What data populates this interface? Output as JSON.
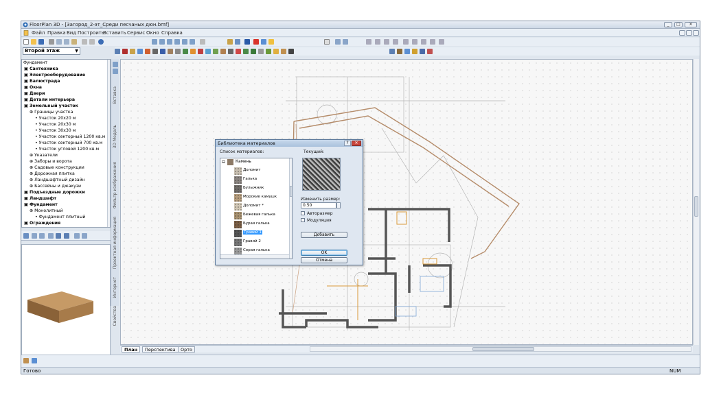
{
  "window": {
    "title": "FloorPlan 3D - [Загород_2-эт_Среди песчаных дюн.bmf]",
    "controls": [
      "_",
      "□",
      "✕"
    ]
  },
  "menu": [
    "Файл",
    "Правка",
    "Вид",
    "Построить",
    "Вставить",
    "Сервис",
    "Окно",
    "Справка"
  ],
  "floor_selector": {
    "value": "Второй этаж"
  },
  "tree": {
    "header": "Фундамент",
    "items": [
      {
        "label": "Сантехника",
        "bold": true,
        "level": 0
      },
      {
        "label": "Электрооборудование",
        "bold": true,
        "level": 0
      },
      {
        "label": "Балюстрада",
        "bold": true,
        "level": 0
      },
      {
        "label": "Окна",
        "bold": true,
        "level": 0
      },
      {
        "label": "Двери",
        "bold": true,
        "level": 0
      },
      {
        "label": "Детали интерьера",
        "bold": true,
        "level": 0
      },
      {
        "label": "Земельный участок",
        "bold": true,
        "level": 0
      },
      {
        "label": "Границы участка",
        "bold": false,
        "level": 1
      },
      {
        "label": "Участок 20х20 м",
        "bold": false,
        "level": 2
      },
      {
        "label": "Участок 20х30 м",
        "bold": false,
        "level": 2
      },
      {
        "label": "Участок 30х30 м",
        "bold": false,
        "level": 2
      },
      {
        "label": "Участок секторный 1200 кв.м",
        "bold": false,
        "level": 2
      },
      {
        "label": "Участок секторный 700 кв.м",
        "bold": false,
        "level": 2
      },
      {
        "label": "Участок угловой 1200 кв.м",
        "bold": false,
        "level": 2
      },
      {
        "label": "Указатели",
        "bold": false,
        "level": 1
      },
      {
        "label": "Заборы и ворота",
        "bold": false,
        "level": 1
      },
      {
        "label": "Садовые конструкции",
        "bold": false,
        "level": 1
      },
      {
        "label": "Дорожная плитка",
        "bold": false,
        "level": 1
      },
      {
        "label": "Ландшафтный дизайн",
        "bold": false,
        "level": 1
      },
      {
        "label": "Бассейны и джакузи",
        "bold": false,
        "level": 1
      },
      {
        "label": "Подъездные дорожки",
        "bold": true,
        "level": 0
      },
      {
        "label": "Ландшафт",
        "bold": true,
        "level": 0
      },
      {
        "label": "Фундамент",
        "bold": true,
        "level": 0
      },
      {
        "label": "Монолитный",
        "bold": false,
        "level": 1
      },
      {
        "label": "Фундамент плитный",
        "bold": false,
        "level": 2
      },
      {
        "label": "Ограждения",
        "bold": true,
        "level": 0
      }
    ]
  },
  "side_tabs": [
    "Вставка",
    "3D Модель",
    "Фильтр изображения",
    "Проектная информация",
    "Интернет",
    "Свойства"
  ],
  "view_tabs": [
    {
      "label": "План",
      "active": true
    },
    {
      "label": "Перспектива",
      "active": false
    },
    {
      "label": "Орто",
      "active": false
    }
  ],
  "status": {
    "left": "Готово",
    "right": "NUM"
  },
  "dialog": {
    "title": "Библиотека материалов",
    "list_label": "Список материалов:",
    "current_label": "Текущий:",
    "category": "Камень",
    "materials": [
      {
        "name": "Доломит",
        "selected": false
      },
      {
        "name": "Галька",
        "selected": false
      },
      {
        "name": "Булыжник",
        "selected": false
      },
      {
        "name": "Морские камушк",
        "selected": false
      },
      {
        "name": "Доломит *",
        "selected": false
      },
      {
        "name": "Бежевая галька",
        "selected": false
      },
      {
        "name": "Бурая галька",
        "selected": false
      },
      {
        "name": "Гравий 1",
        "selected": true
      },
      {
        "name": "Гравий 2",
        "selected": false
      },
      {
        "name": "Серая галька",
        "selected": false
      }
    ],
    "resize_label": "Изменить размер:",
    "size_value": "0.50",
    "autosize_label": "Авторазмер",
    "modulation_label": "Модуляция",
    "add_button": "Добавить",
    "ok_button": "OK",
    "cancel_button": "Отмена",
    "help_button": "?",
    "close_button": "✕"
  }
}
